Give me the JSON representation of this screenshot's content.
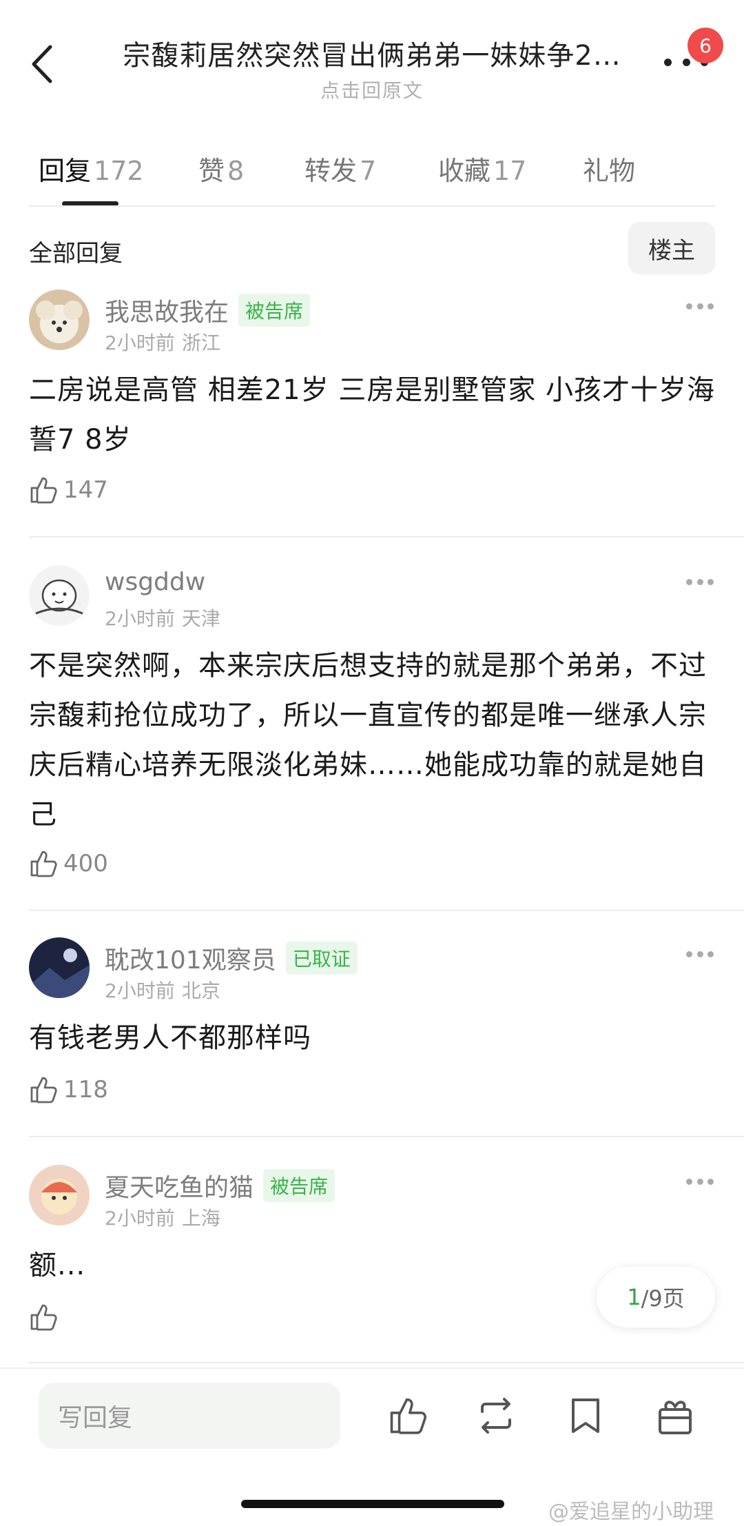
{
  "header": {
    "title": "宗馥莉居然突然冒出俩弟弟一妹妹争2…",
    "subtitle": "点击回原文",
    "notification_count": "6"
  },
  "tabs": [
    {
      "label": "回复",
      "count": "172"
    },
    {
      "label": "赞",
      "count": "8"
    },
    {
      "label": "转发",
      "count": "7"
    },
    {
      "label": "收藏",
      "count": "17"
    },
    {
      "label": "礼物",
      "count": ""
    }
  ],
  "filter": {
    "all_replies": "全部回复",
    "op_only": "楼主"
  },
  "comments": [
    {
      "user": "我思故我在",
      "tag": "被告席",
      "time": "2小时前",
      "location": "浙江",
      "text": "二房说是高管 相差21岁 三房是别墅管家 小孩才十岁海誓7 8岁",
      "likes": "147"
    },
    {
      "user": "wsgddw",
      "tag": "",
      "time": "2小时前",
      "location": "天津",
      "text": "不是突然啊，本来宗庆后想支持的就是那个弟弟，不过宗馥莉抢位成功了，所以一直宣传的都是唯一继承人宗庆后精心培养无限淡化弟妹……她能成功靠的就是她自己",
      "likes": "400"
    },
    {
      "user": "耽改101观察员",
      "tag": "已取证",
      "time": "2小时前",
      "location": "北京",
      "text": "有钱老男人不都那样吗",
      "likes": "118"
    },
    {
      "user": "夏天吃鱼的猫",
      "tag": "被告席",
      "time": "2小时前",
      "location": "上海",
      "text": "额...",
      "likes": ""
    }
  ],
  "pager": {
    "current": "1",
    "total": "/9页"
  },
  "bottom_bar": {
    "reply_placeholder": "写回复"
  },
  "watermark": "@爱追星的小助理",
  "colors": {
    "tag_green": "#3ab34a",
    "tag_bg": "#e9f7ea",
    "badge_red": "#f04a4a",
    "pager_green": "#2ea34a"
  }
}
